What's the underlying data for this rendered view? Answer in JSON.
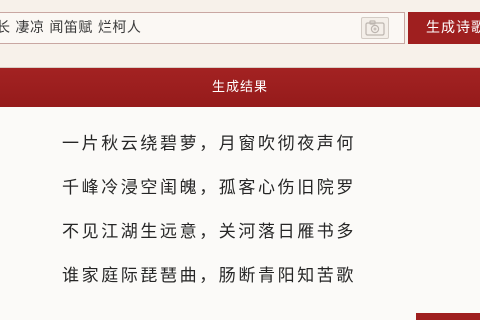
{
  "input": {
    "keywords": "长 凄凉 闻笛赋 烂柯人"
  },
  "toolbar": {
    "camera_icon": "camera-icon",
    "generate_label": "生成诗歌"
  },
  "result": {
    "title": "生成结果",
    "lines": [
      "一片秋云绕碧萝，月窗吹彻夜声何",
      "千峰冷浸空闺魄，孤客心伤旧院罗",
      "不见江湖生远意，关河落日雁书多",
      "谁家庭际琵琶曲，肠断青阳知苦歌"
    ]
  },
  "colors": {
    "accent": "#9f1f1f",
    "background": "#f7f1ea",
    "panel": "#fbfaf8"
  }
}
